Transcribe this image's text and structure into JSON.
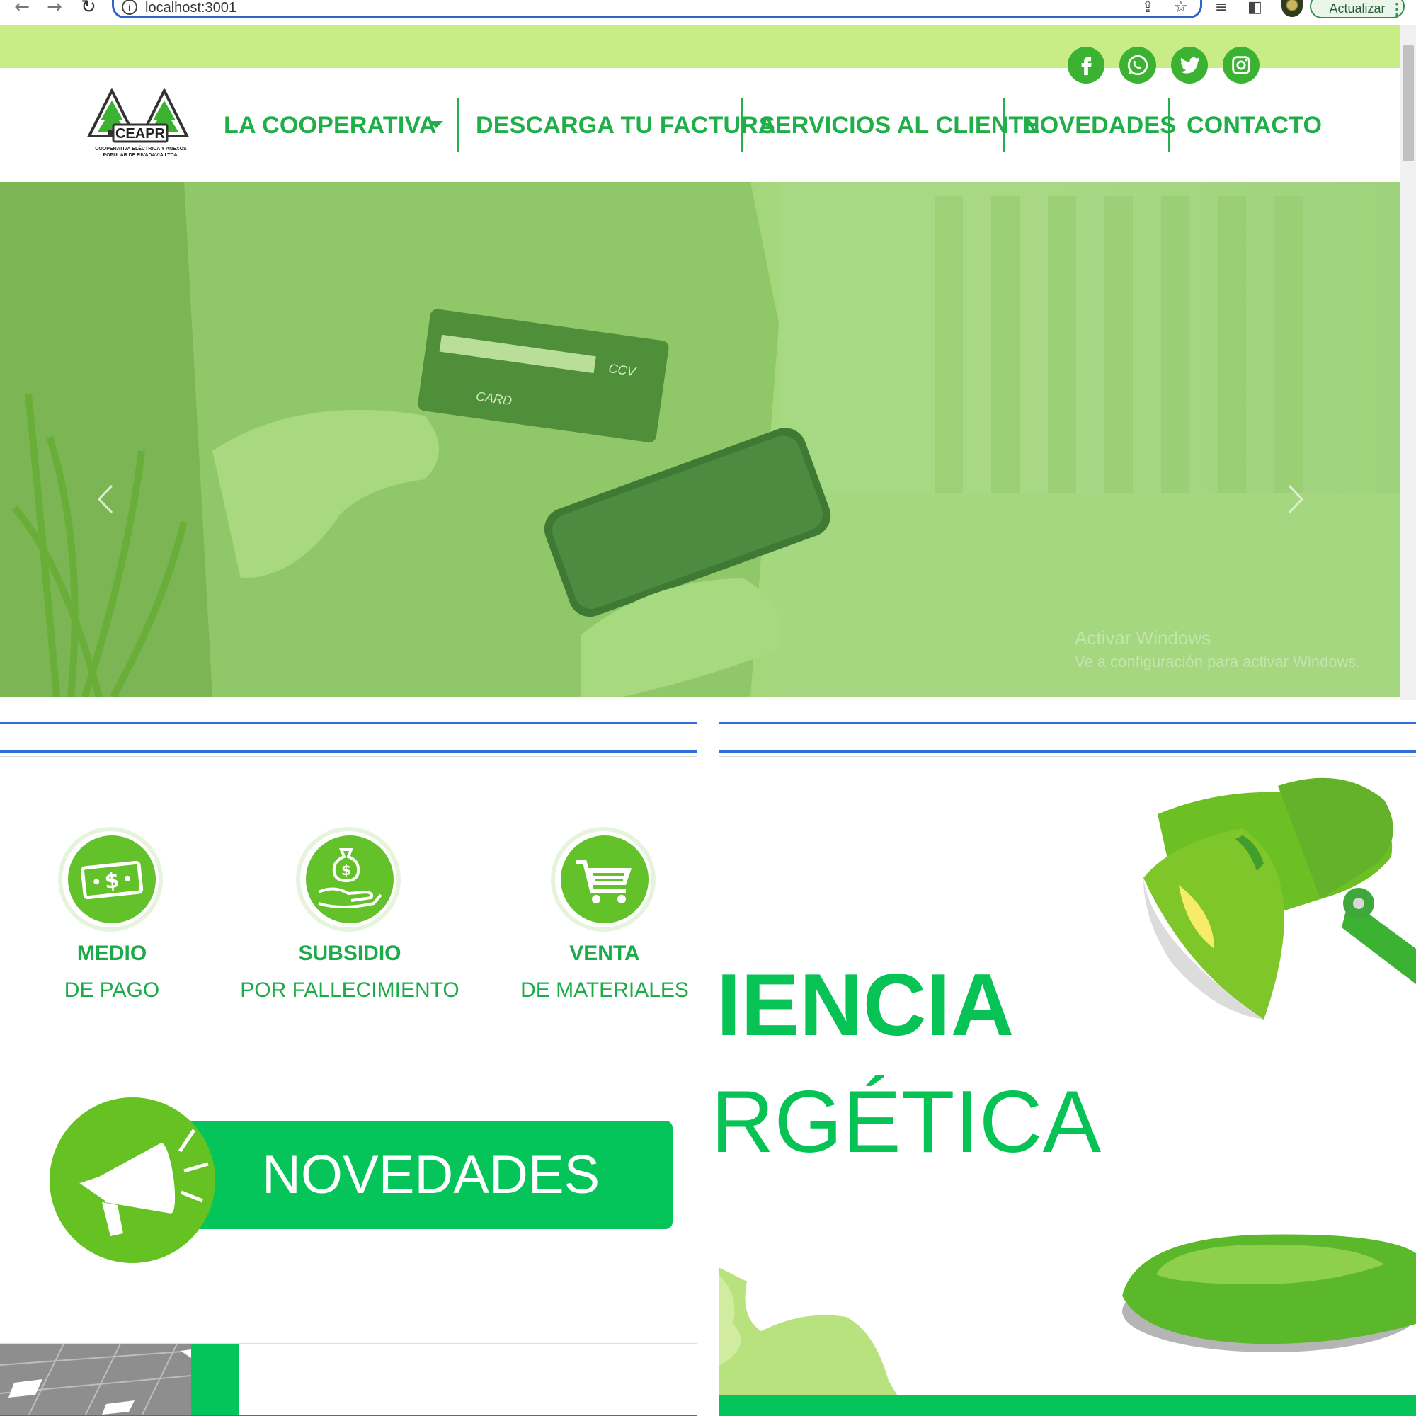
{
  "browser": {
    "url": "localhost:3001",
    "update_label": "Actualizar"
  },
  "colors": {
    "brand_green": "#1fae48",
    "top_bar": "#c8ec86",
    "accent_green": "#05c45a"
  },
  "social": [
    "facebook-icon",
    "whatsapp-icon",
    "twitter-icon",
    "instagram-icon"
  ],
  "logo": {
    "name": "CEAPR",
    "caption_line1": "COOPERATIVA ELÉCTRICA Y ANEXOS",
    "caption_line2": "POPULAR DE RIVADAVIA LTDA."
  },
  "nav": {
    "items": [
      {
        "label": "LA COOPERATIVA"
      },
      {
        "label": "DESCARGA TU FACTURA"
      },
      {
        "label": "SERVICIOS AL CLIENTE"
      },
      {
        "label": "NOVEDADES"
      },
      {
        "label": "CONTACTO"
      }
    ]
  },
  "hero": {
    "card_label": "CCV",
    "card_text": "CARD",
    "watermark_title": "Activar Windows",
    "watermark_sub": "Ve a configuración para activar Windows."
  },
  "services": [
    {
      "title": "MEDIO",
      "subtitle": "DE PAGO",
      "icon": "money-icon"
    },
    {
      "title": "SUBSIDIO",
      "subtitle": "POR FALLECIMIENTO",
      "icon": "money-bag-hand-icon"
    },
    {
      "title": "VENTA",
      "subtitle": "DE MATERIALES",
      "icon": "shopping-cart-icon"
    }
  ],
  "novedades": {
    "label": "NOVEDADES"
  },
  "efficiency": {
    "line1": "IENCIA",
    "line2": "RGÉTICA"
  }
}
